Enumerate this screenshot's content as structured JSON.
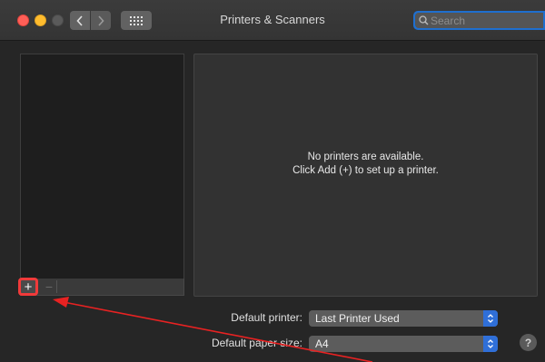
{
  "window": {
    "title": "Printers & Scanners",
    "search_placeholder": "Search"
  },
  "printer_list": {
    "add_label": "+",
    "remove_label": "−"
  },
  "detail": {
    "empty_line1": "No printers are available.",
    "empty_line2": "Click Add (+) to set up a printer."
  },
  "settings": {
    "default_printer_label": "Default printer:",
    "default_printer_value": "Last Printer Used",
    "default_paper_label": "Default paper size:",
    "default_paper_value": "A4"
  },
  "help_label": "?",
  "colors": {
    "annotation": "#e82222",
    "accent": "#2f6fd8"
  }
}
